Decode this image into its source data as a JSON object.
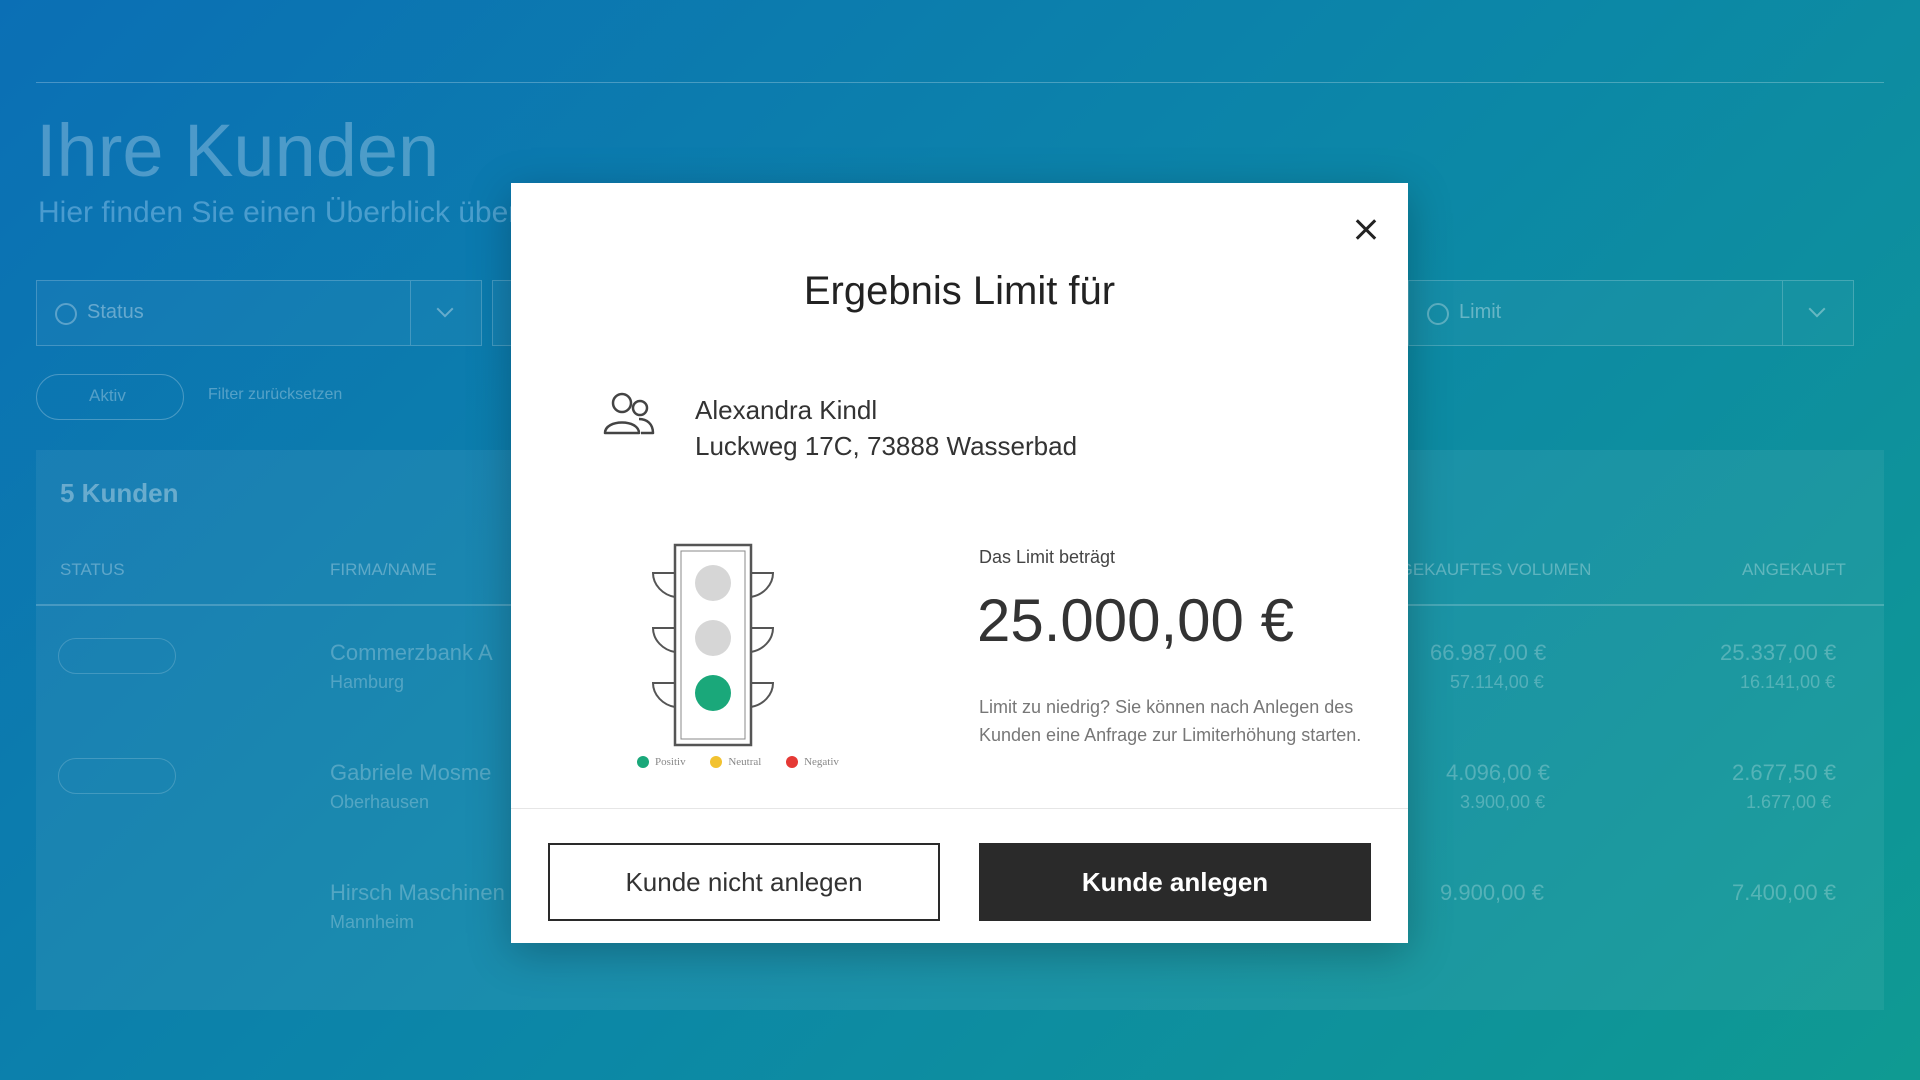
{
  "background": {
    "title": "Ihre Kunden",
    "subtitle": "Hier finden Sie einen Überblick über",
    "filters": {
      "status_label": "Status",
      "limit_label": "Limit"
    },
    "active_chip": "Aktiv",
    "reset_filter": "Filter zurücksetzen",
    "customer_count": "5 Kunden",
    "columns": [
      "STATUS",
      "FIRMA/NAME",
      "ANGEKAUFTES VOLUMEN",
      "ANGEKAUFT"
    ],
    "rows": [
      {
        "name": "Commerzbank A",
        "sub": "Hamburg",
        "vol1": "66.987,00 €",
        "vol2": "57.114,00 €",
        "val1": "25.337,00 €",
        "val2": "16.141,00 €"
      },
      {
        "name": "Gabriele Mosme",
        "sub": "Oberhausen",
        "vol1": "4.096,00 €",
        "vol2": "3.900,00 €",
        "val1": "2.677,50 €",
        "val2": "1.677,00 €"
      },
      {
        "name": "Hirsch Maschinen",
        "sub": "Mannheim",
        "vol1": "9.900,00 €",
        "vol2": "",
        "val1": "7.400,00 €",
        "val2": ""
      }
    ]
  },
  "modal": {
    "title": "Ergebnis Limit für",
    "customer_name": "Alexandra Kindl",
    "customer_address": "Luckweg 17C, 73888 Wasserbad",
    "limit_label": "Das Limit beträgt",
    "limit_amount": "25.000,00 €",
    "hint": "Limit zu niedrig? Sie können nach Anlegen des Kunden eine Anfrage zur Limiterhöhung starten.",
    "legend": [
      {
        "label": "Positiv",
        "color": "#1aa87a"
      },
      {
        "label": "Neutral",
        "color": "#f2c230"
      },
      {
        "label": "Negativ",
        "color": "#e53935"
      }
    ],
    "traffic_light_state": "positive",
    "cancel_button": "Kunde nicht anlegen",
    "confirm_button": "Kunde anlegen"
  }
}
